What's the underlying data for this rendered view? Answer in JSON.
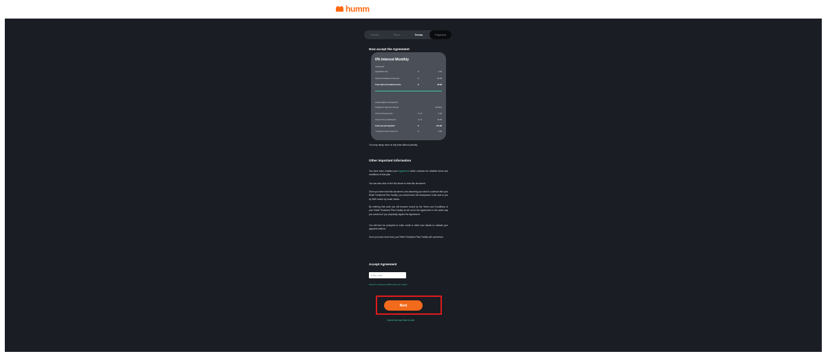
{
  "brand": {
    "name": "humm",
    "accent": "#ff6a13"
  },
  "tabs": [
    "Details",
    "Plans",
    "Terms",
    "Payment"
  ],
  "heading_accept": "Now accept the Agreement",
  "card": {
    "title": "0% Interest Monthly",
    "upfront_label": "UPFRONT",
    "upfront_rows": [
      {
        "label": "Application Fee",
        "mid": "$",
        "value": "0.00"
      },
      {
        "label": "Optional Installment Payment",
        "mid": "$",
        "value": "96.68"
      },
      {
        "label": "Total Upfront Installment Due",
        "mid": "$",
        "value": "96.68"
      }
    ],
    "installments_label": "INSTALMENT PAYMENTS",
    "installment_rows": [
      {
        "label": "Installment Payment Interval",
        "mid": "",
        "value": "Monthly"
      },
      {
        "label": "Account Keeping Fee",
        "mid": "2 x $",
        "value": "0.00"
      },
      {
        "label": "Interest Free Installments",
        "mid": "2 x $",
        "value": "19.68"
      },
      {
        "label": "Total Amount Payable*",
        "mid": "$",
        "value": "401.86"
      },
      {
        "label": "* Includes Interest Clear off",
        "mid": "$",
        "value": "0.00"
      }
    ]
  },
  "repay_note": "You may repay more at any time without penalty.",
  "heading_other": "Other important information",
  "para1": {
    "pre": "You have been emailed your ",
    "link": "Agreement",
    "post": " which contains the detailed terms and conditions of that plan."
  },
  "para2": "You can also click on the link above to read this document.",
  "para3": "Once you have read this document, and assuming you wish to continue with your Relief Treatment Plan Facility, you should enter the Acceptance Code sent to you by SMS and/or by email, below.",
  "para4": "By entering that code you will become bound by the Terms and Conditions of your Relief Treatment Plan Facility as set out in the Agreement in the same way you would as if you physically signed the Agreement.",
  "para5": "You will then be prompted to enter credit or debit card details to validate your payment method.",
  "para6": "Once you have done that, your Relief Treatment Plan Facility will commence.",
  "heading_accept_agreement": "Accept Agreement",
  "code_placeholder": "Enter code",
  "resend_link": "Haven't received a SMS with your code?",
  "next_label": "Next",
  "cancel_link": "Cancel and go back to cart",
  "colors": {
    "background": "#1a1d23",
    "card": "#4a4f58",
    "accent_green": "#3fc9a6",
    "button": "#f26a1b",
    "highlight": "#e01b1b"
  }
}
